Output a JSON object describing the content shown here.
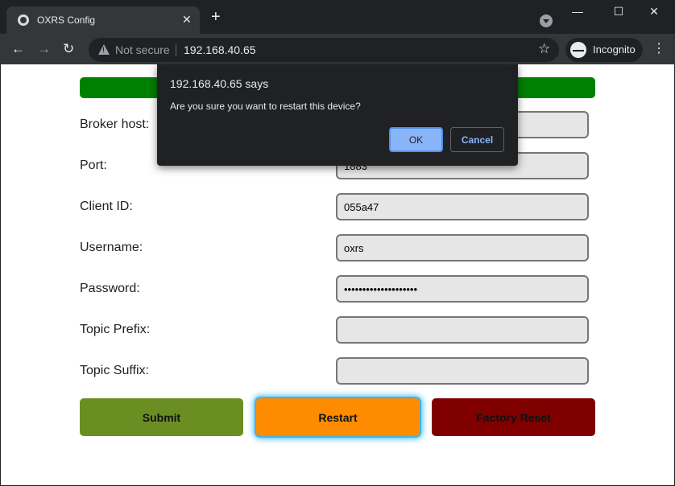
{
  "browser": {
    "tab_title": "OXRS Config",
    "tab_close": "✕",
    "new_tab": "+",
    "window_controls": {
      "minimize": "—",
      "maximize": "☐",
      "close": "✕"
    },
    "nav": {
      "back": "←",
      "forward": "→",
      "reload": "↻"
    },
    "security_label": "Not secure",
    "url": "192.168.40.65",
    "bookmark_star": "☆",
    "incognito_label": "Incognito",
    "menu": "⋮"
  },
  "form": {
    "rows": [
      {
        "label": "Broker host:",
        "value": ""
      },
      {
        "label": "Port:",
        "value": "1883"
      },
      {
        "label": "Client ID:",
        "value": "055a47"
      },
      {
        "label": "Username:",
        "value": "oxrs"
      },
      {
        "label": "Password:",
        "value": "••••••••••••••••••••"
      },
      {
        "label": "Topic Prefix:",
        "value": ""
      },
      {
        "label": "Topic Suffix:",
        "value": ""
      }
    ],
    "buttons": {
      "submit": "Submit",
      "restart": "Restart",
      "factory_reset": "Factory Reset"
    },
    "colors": {
      "status_bar": "#008000",
      "submit": "#6b8e23",
      "restart": "#ff8c00",
      "factory_reset": "#800000"
    }
  },
  "dialog": {
    "title": "192.168.40.65 says",
    "message": "Are you sure you want to restart this device?",
    "ok": "OK",
    "cancel": "Cancel"
  }
}
